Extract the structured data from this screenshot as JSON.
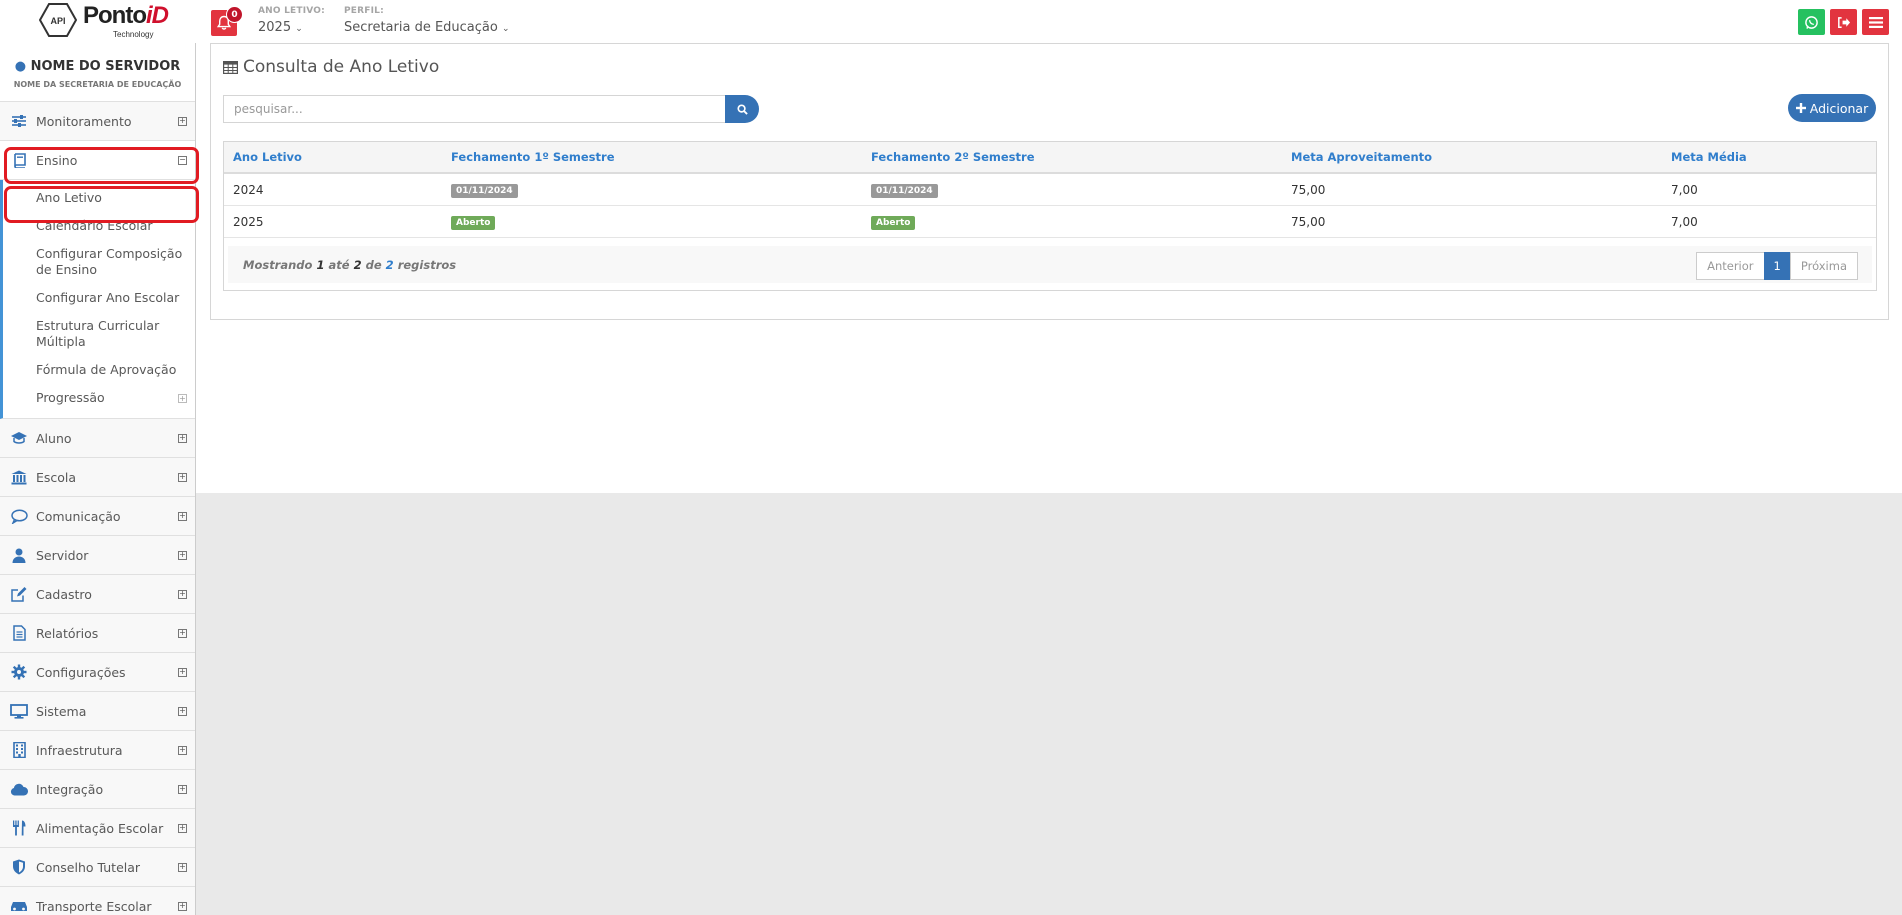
{
  "navbar": {
    "logo": {
      "badge": "API",
      "brand_main": "Ponto",
      "brand_accent": "iD",
      "brand_sub": "Technology"
    },
    "notifications_count": "0",
    "ano_letivo": {
      "label": "ANO LETIVO:",
      "value": "2025"
    },
    "perfil": {
      "label": "PERFIL:",
      "value": "Secretaria de Educação"
    },
    "colors": {
      "whatsapp": "#25c160",
      "logout": "#e2343f",
      "menu": "#e2343f"
    }
  },
  "sidebar": {
    "user_name": "NOME DO SERVIDOR",
    "user_org": "NOME DA SECRETARIA DE EDUCAÇÃO",
    "items": [
      {
        "label": "Monitoramento",
        "icon": "sliders-icon"
      },
      {
        "label": "Ensino",
        "icon": "book-icon"
      },
      {
        "label": "Aluno",
        "icon": "graduation-cap-icon"
      },
      {
        "label": "Escola",
        "icon": "institution-icon"
      },
      {
        "label": "Comunicação",
        "icon": "chat-bubble-icon"
      },
      {
        "label": "Servidor",
        "icon": "user-icon"
      },
      {
        "label": "Cadastro",
        "icon": "edit-icon"
      },
      {
        "label": "Relatórios",
        "icon": "file-text-icon"
      },
      {
        "label": "Configurações",
        "icon": "gear-icon"
      },
      {
        "label": "Sistema",
        "icon": "desktop-icon"
      },
      {
        "label": "Infraestrutura",
        "icon": "building-icon"
      },
      {
        "label": "Integração",
        "icon": "cloud-icon"
      },
      {
        "label": "Alimentação Escolar",
        "icon": "cutlery-icon"
      },
      {
        "label": "Conselho Tutelar",
        "icon": "shield-icon"
      },
      {
        "label": "Transporte Escolar",
        "icon": "car-icon"
      }
    ],
    "ensino_submenu": [
      "Ano Letivo",
      "Calendário Escolar",
      "Configurar Composição de Ensino",
      "Configurar Ano Escolar",
      "Estrutura Curricular Múltipla",
      "Fórmula de Aprovação",
      "Progressão"
    ]
  },
  "main": {
    "title": "Consulta de Ano Letivo",
    "search_placeholder": "pesquisar...",
    "add_label": "Adicionar",
    "table": {
      "headers": [
        "Ano Letivo",
        "Fechamento 1º Semestre",
        "Fechamento 2º Semestre",
        "Meta Aproveitamento",
        "Meta Média"
      ],
      "rows": [
        {
          "ano": "2024",
          "sem1": "01/11/2024",
          "sem2": "01/11/2024",
          "meta_aprov": "75,00",
          "meta_media": "7,00"
        },
        {
          "ano": "2025",
          "sem1": "Aberto",
          "sem2": "Aberto",
          "meta_aprov": "75,00",
          "meta_media": "7,00"
        }
      ]
    },
    "footer": {
      "mostrando": "Mostrando",
      "de_num": "1",
      "ate": "até",
      "ate_num": "2",
      "de": "de",
      "total": "2",
      "registros": "registros"
    },
    "pager": {
      "prev": "Anterior",
      "current": "1",
      "next": "Próxima"
    }
  }
}
